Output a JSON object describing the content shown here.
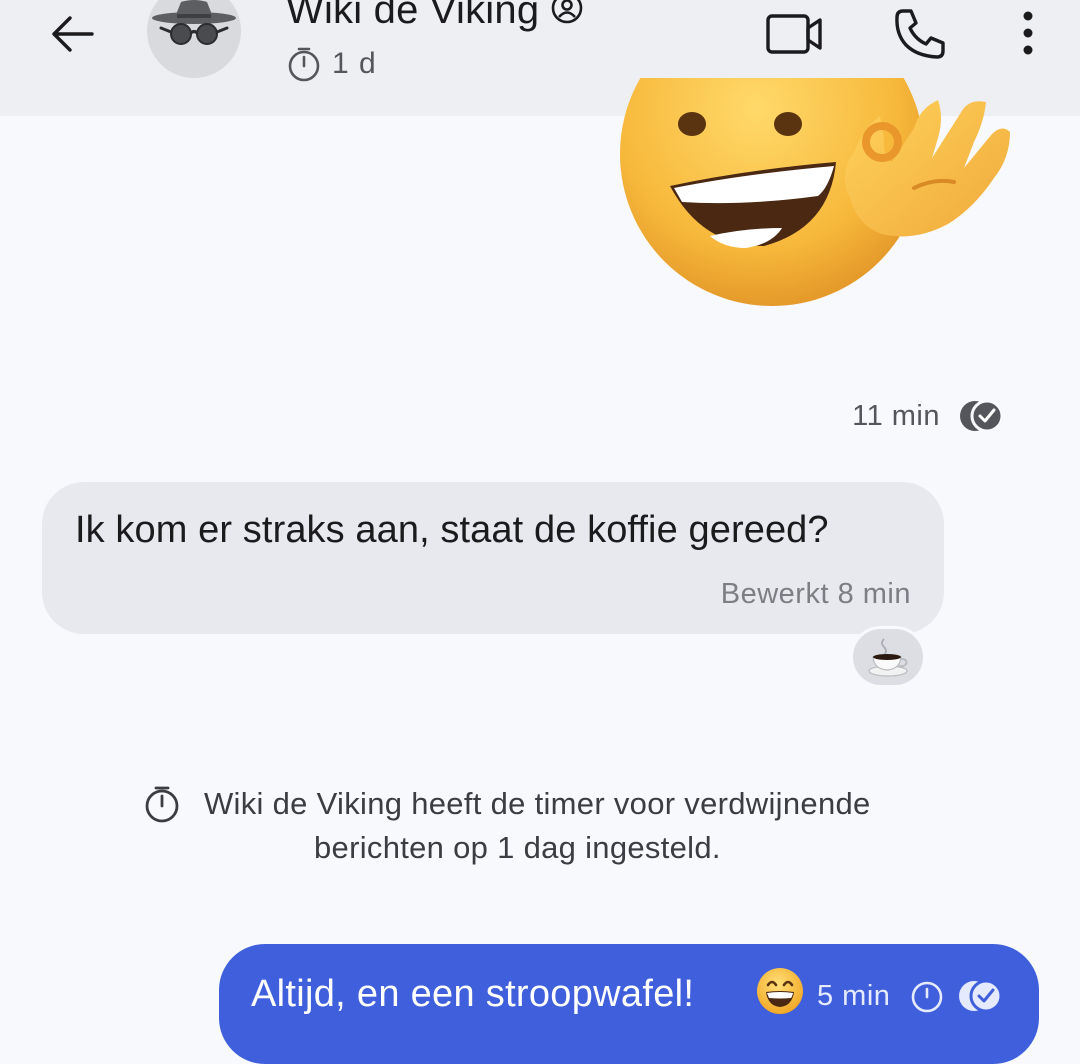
{
  "header": {
    "contact_name": "Wiki de Viking",
    "disappearing_timer": "1 d",
    "icons": {
      "back": "arrow-left-icon",
      "avatar": "incognito-avatar-icon",
      "name_badge": "at-sign-icon",
      "timer": "stopwatch-icon",
      "video": "video-camera-icon",
      "call": "phone-icon",
      "menu": "more-vertical-icon"
    }
  },
  "conversation": {
    "sticker": {
      "icon": "ok-hand-smiling-face-sticker"
    },
    "sticker_meta": {
      "time": "11 min",
      "status_icon": "read-receipt-icon"
    },
    "incoming": {
      "text": "Ik kom er straks aan, staat de koffie gereed?",
      "meta": "Bewerkt 8 min",
      "reaction_icon": "coffee-cup-icon"
    },
    "system": {
      "line1": "Wiki de Viking heeft de timer voor verdwijnende",
      "line2": "berichten op 1 dag ingesteld.",
      "icon": "stopwatch-icon"
    },
    "outgoing": {
      "text": "Altijd, en een stroopwafel!",
      "emoji_icon": "grinning-face-icon",
      "time": "5 min",
      "timer_icon": "stopwatch-icon",
      "status_icon": "read-receipt-icon"
    }
  },
  "colors": {
    "header_bg": "#eeeff3",
    "page_bg": "#f8f9fc",
    "incoming_bubble": "#e7e9ef",
    "outgoing_bubble": "#3f5fdc",
    "muted_text": "#55565b"
  }
}
